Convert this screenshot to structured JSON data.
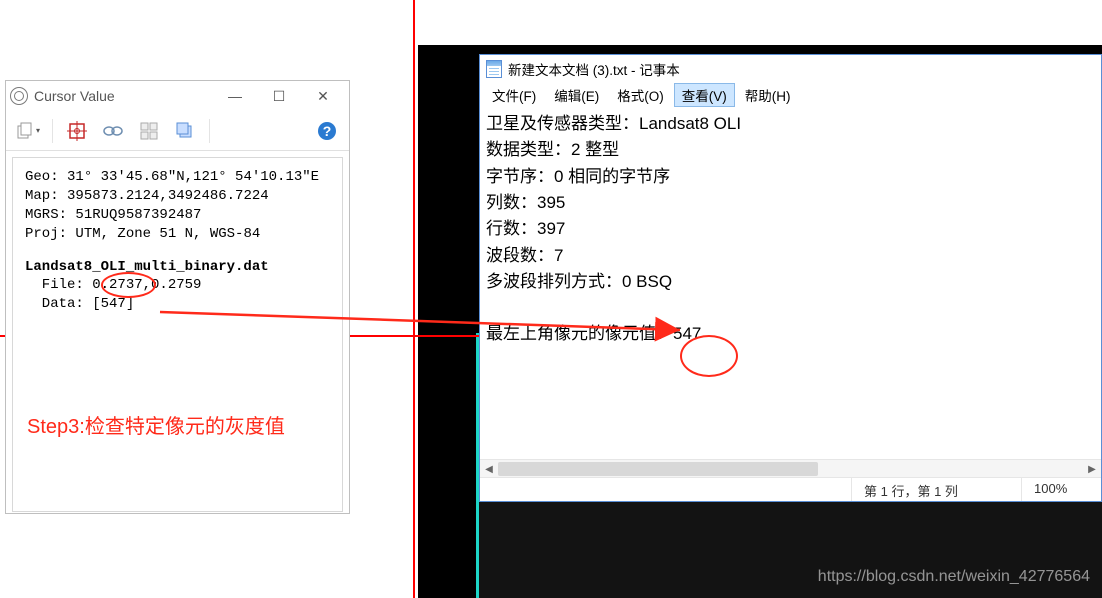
{
  "cursor_window": {
    "title": "Cursor Value",
    "toolbar": {
      "copy": "copy-icon",
      "target": "crosshair-icon",
      "link": "link-icon",
      "grid": "pixel-grid-icon",
      "windows": "cascade-icon",
      "help": "help-icon"
    },
    "geo_label": "Geo: ",
    "geo_value": "31° 33′45.68″N,121° 54′10.13″E",
    "map_label": "Map: ",
    "map_value": "395873.2124,3492486.7224",
    "mgrs_label": "MGRS: ",
    "mgrs_value": "51RUQ9587392487",
    "proj_label": "Proj: ",
    "proj_value": "UTM, Zone 51 N, WGS-84",
    "dataset_name": "Landsat8_OLI_multi_binary.dat",
    "file_label": "  File: ",
    "file_value": "0.2737,0.2759",
    "data_label": "  Data: ",
    "data_value": "[547]",
    "step3_label": "Step3:检查特定像元的灰度值"
  },
  "notepad": {
    "title": "新建文本文档 (3).txt - 记事本",
    "menu": {
      "file": "文件(F)",
      "edit": "编辑(E)",
      "format": "格式(O)",
      "view": "查看(V)",
      "help": "帮助(H)"
    },
    "lines": {
      "l1_label": "卫星及传感器类型：",
      "l1_value": "Landsat8 OLI",
      "l2_label": "数据类型：",
      "l2_value": "2 整型",
      "l3_label": "字节序：",
      "l3_value": "0 相同的字节序",
      "l4_label": "列数：",
      "l4_value": "395",
      "l5_label": "行数：",
      "l5_value": "397",
      "l6_label": "波段数：",
      "l6_value": "7",
      "l7_label": "多波段排列方式：",
      "l7_value": "0 BSQ",
      "l8_label": "最左上角像元的像元值：",
      "l8_value": "547"
    },
    "status": {
      "pos": "第 1 行，第 1 列",
      "zoom": "100%"
    }
  },
  "watermark": "https://blog.csdn.net/weixin_42776564"
}
